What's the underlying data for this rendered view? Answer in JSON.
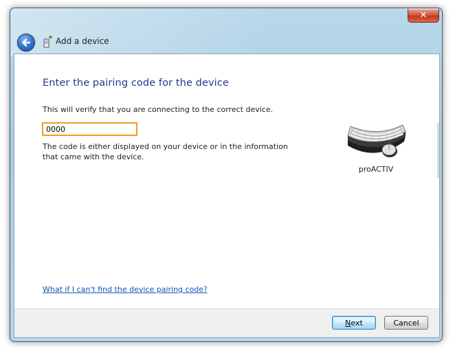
{
  "window": {
    "title": "Add a device",
    "close_symbol": "✕",
    "back_icon": "back-arrow-icon",
    "title_icon": "add-device-icon"
  },
  "main": {
    "heading": "Enter the pairing code for the device",
    "subtext": "This will verify that you are connecting to the correct device.",
    "code_value": "0000",
    "hint": "The code is either displayed on your device or in the information that came with the device.",
    "device": {
      "icon": "keyboard-mouse-icon",
      "name": "proACTIV"
    },
    "help_link": "What if I can't find the device pairing code?"
  },
  "footer": {
    "next_accel": "N",
    "next_rest": "ext",
    "cancel_label": "Cancel"
  },
  "colors": {
    "heading": "#1e3a8c",
    "link": "#0e56b4",
    "input_border": "#f29c1f",
    "close_button": "#c23a1e"
  }
}
